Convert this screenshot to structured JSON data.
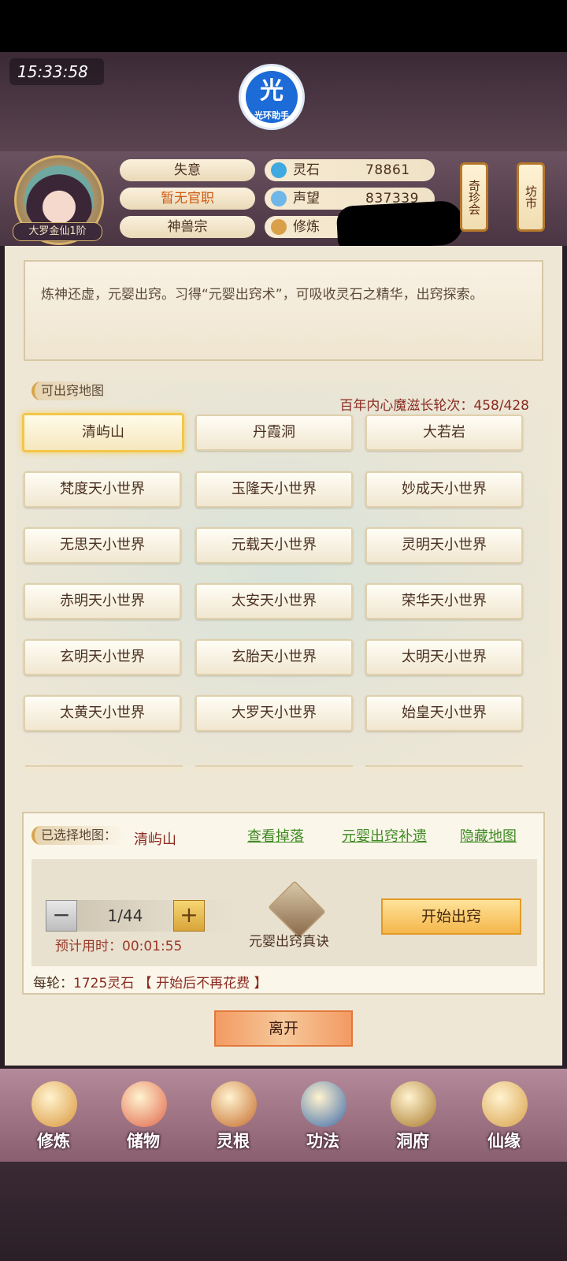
{
  "status": {
    "time": "15:33:58"
  },
  "helper_badge": {
    "glyph": "光",
    "caption": "光环助手"
  },
  "player": {
    "rank": "大罗金仙1阶",
    "mood": "失意",
    "office": "暂无官职",
    "sect": "神兽宗"
  },
  "resources": [
    {
      "label": "灵石",
      "value": "78861",
      "icon": "spirit-stone-icon"
    },
    {
      "label": "声望",
      "value": "837339",
      "icon": "prestige-icon"
    },
    {
      "label": "修炼",
      "value": "",
      "icon": "cultivate-icon"
    }
  ],
  "lanterns": {
    "treasure": "奇珍会",
    "market": "坊市"
  },
  "description": "炼神还虚，元婴出窍。习得“元婴出窍术”，可吸收灵石之精华，出窍探索。",
  "maps": {
    "title": "可出窍地图",
    "demon_counter": "百年内心魔滋长轮次：458/428",
    "selected_index": 0,
    "items": [
      "清屿山",
      "丹霞洞",
      "大若岩",
      "梵度天小世界",
      "玉隆天小世界",
      "妙成天小世界",
      "无思天小世界",
      "元载天小世界",
      "灵明天小世界",
      "赤明天小世界",
      "太安天小世界",
      "荣华天小世界",
      "玄明天小世界",
      "玄胎天小世界",
      "太明天小世界",
      "太黄天小世界",
      "大罗天小世界",
      "始皇天小世界"
    ]
  },
  "selection": {
    "label": "已选择地图：",
    "map_name": "清屿山",
    "links": [
      "查看掉落",
      "元婴出窍补遗",
      "隐藏地图"
    ]
  },
  "rounds": {
    "value": "1/44",
    "minus": "−",
    "plus": "+",
    "eta": "预计用时：00:01:55"
  },
  "book": {
    "label": "元婴出窍真诀"
  },
  "start_button": "开始出窍",
  "cost": {
    "prefix": "每轮：",
    "amount": "1725灵石",
    "note": "【 开始后不再花费 】"
  },
  "leave_button": "离开",
  "nav": [
    {
      "label": "修炼",
      "icon": "meditating-monk-icon",
      "color": "#d9963a"
    },
    {
      "label": "储物",
      "icon": "treasure-bag-icon",
      "color": "#e0654a"
    },
    {
      "label": "灵根",
      "icon": "spirit-root-icon",
      "color": "#c46a2a"
    },
    {
      "label": "功法",
      "icon": "scripture-book-icon",
      "color": "#3d6aa8"
    },
    {
      "label": "洞府",
      "icon": "cave-dwelling-icon",
      "color": "#a8782a"
    },
    {
      "label": "仙缘",
      "icon": "gourd-yinyang-icon",
      "color": "#d8a04a"
    }
  ]
}
